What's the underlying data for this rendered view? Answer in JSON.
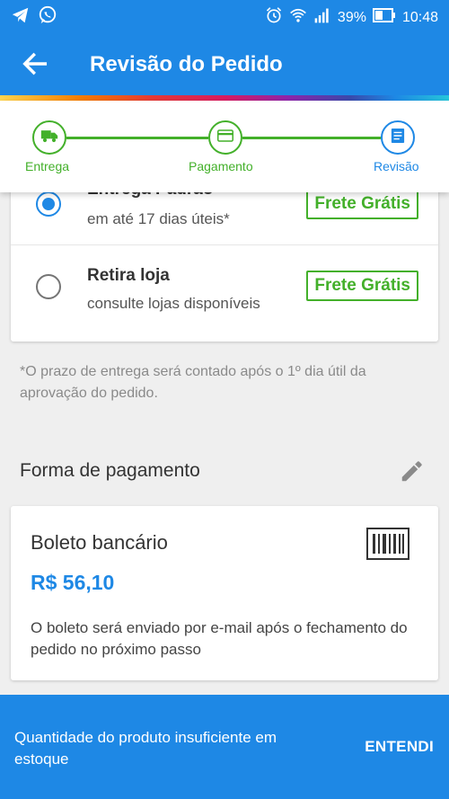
{
  "status_bar": {
    "battery": "39%",
    "time": "10:48",
    "icons": [
      "telegram-icon",
      "whatsapp-icon",
      "alarm-icon",
      "wifi-icon",
      "signal-icon",
      "battery-icon"
    ]
  },
  "app_bar": {
    "title": "Revisão do Pedido",
    "back_icon": "arrow-back-icon"
  },
  "stepper": {
    "steps": [
      {
        "label": "Entrega",
        "icon": "truck-icon",
        "state": "done"
      },
      {
        "label": "Pagamento",
        "icon": "card-icon",
        "state": "done"
      },
      {
        "label": "Revisão",
        "icon": "document-icon",
        "state": "active"
      }
    ]
  },
  "shipping": {
    "options": [
      {
        "title": "Entrega Padrão",
        "subtitle": "em até 17 dias úteis*",
        "badge": "Frete Grátis",
        "selected": true
      },
      {
        "title": "Retira loja",
        "subtitle": "consulte lojas disponíveis",
        "badge": "Frete Grátis",
        "selected": false
      }
    ],
    "note": "*O prazo de entrega será contado após o 1º dia útil da aprovação do pedido."
  },
  "payment": {
    "section_title": "Forma de pagamento",
    "method": "Boleto bancário",
    "price": "R$ 56,10",
    "description": "O boleto será enviado por e-mail após o fechamento do pedido no próximo passo"
  },
  "snackbar": {
    "message": "Quantidade do produto insuficiente em estoque",
    "action": "ENTENDI"
  },
  "colors": {
    "primary": "#1e88e5",
    "success": "#43b02a"
  }
}
